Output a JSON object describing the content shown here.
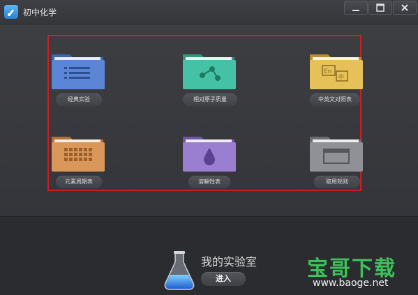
{
  "window": {
    "title": "初中化学",
    "controls": {
      "minimize": "minimize",
      "maximize": "maximize",
      "close": "close"
    }
  },
  "tiles": [
    {
      "label": "经典实验",
      "icon": "list-icon",
      "color": "#5b86d6"
    },
    {
      "label": "相对原子质量",
      "icon": "molecule-icon",
      "color": "#45c2a6"
    },
    {
      "label": "中英文对照表",
      "icon": "translate-icon",
      "color": "#e6c15a"
    },
    {
      "label": "元素周期表",
      "icon": "periodic-table-icon",
      "color": "#d9975a"
    },
    {
      "label": "溶解性表",
      "icon": "drop-icon",
      "color": "#9a7fd0"
    },
    {
      "label": "取用规则",
      "icon": "window-icon",
      "color": "#8f9196"
    }
  ],
  "lab": {
    "title": "我的实验室",
    "enter_label": "进入"
  },
  "watermark": {
    "brand": "宝哥下载",
    "url": "www.baoge.net"
  }
}
